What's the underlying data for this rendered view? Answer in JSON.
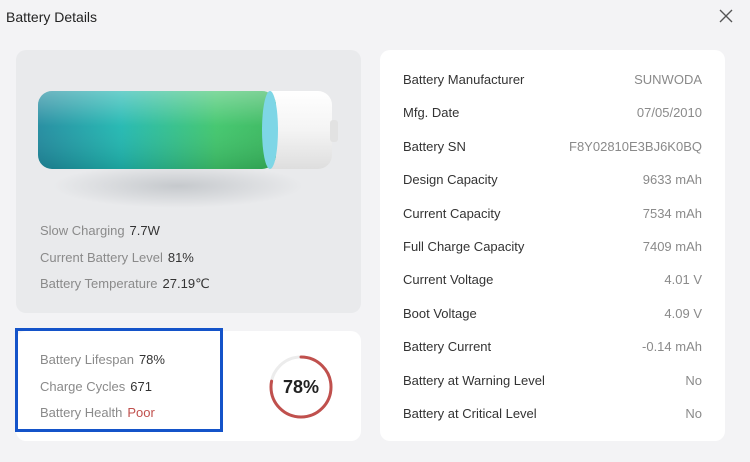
{
  "window": {
    "title": "Battery Details"
  },
  "battery": {
    "charge_fraction": 0.81,
    "stats": [
      {
        "label": "Slow Charging",
        "value": "7.7W"
      },
      {
        "label": "Current Battery Level",
        "value": "81%"
      },
      {
        "label": "Battery Temperature",
        "value": "27.19℃"
      }
    ]
  },
  "lifespan": {
    "items": [
      {
        "label": "Battery Lifespan",
        "value": "78%"
      },
      {
        "label": "Charge Cycles",
        "value": "671"
      },
      {
        "label": "Battery Health",
        "value": "Poor"
      }
    ],
    "ring_text": "78%",
    "ring_fraction": 0.78,
    "ring_color": "#c0504d",
    "health_color": "#c0504d",
    "highlight_color": "#1453c9"
  },
  "details": [
    {
      "label": "Battery Manufacturer",
      "value": "SUNWODA"
    },
    {
      "label": "Mfg. Date",
      "value": "07/05/2010"
    },
    {
      "label": "Battery SN",
      "value": "F8Y02810E3BJ6K0BQ"
    },
    {
      "label": "Design Capacity",
      "value": "9633 mAh"
    },
    {
      "label": "Current Capacity",
      "value": "7534 mAh"
    },
    {
      "label": "Full Charge Capacity",
      "value": "7409 mAh"
    },
    {
      "label": "Current Voltage",
      "value": "4.01 V"
    },
    {
      "label": "Boot Voltage",
      "value": "4.09 V"
    },
    {
      "label": "Battery Current",
      "value": "-0.14 mAh"
    },
    {
      "label": "Battery at Warning Level",
      "value": "No"
    },
    {
      "label": "Battery at Critical Level",
      "value": "No"
    }
  ]
}
